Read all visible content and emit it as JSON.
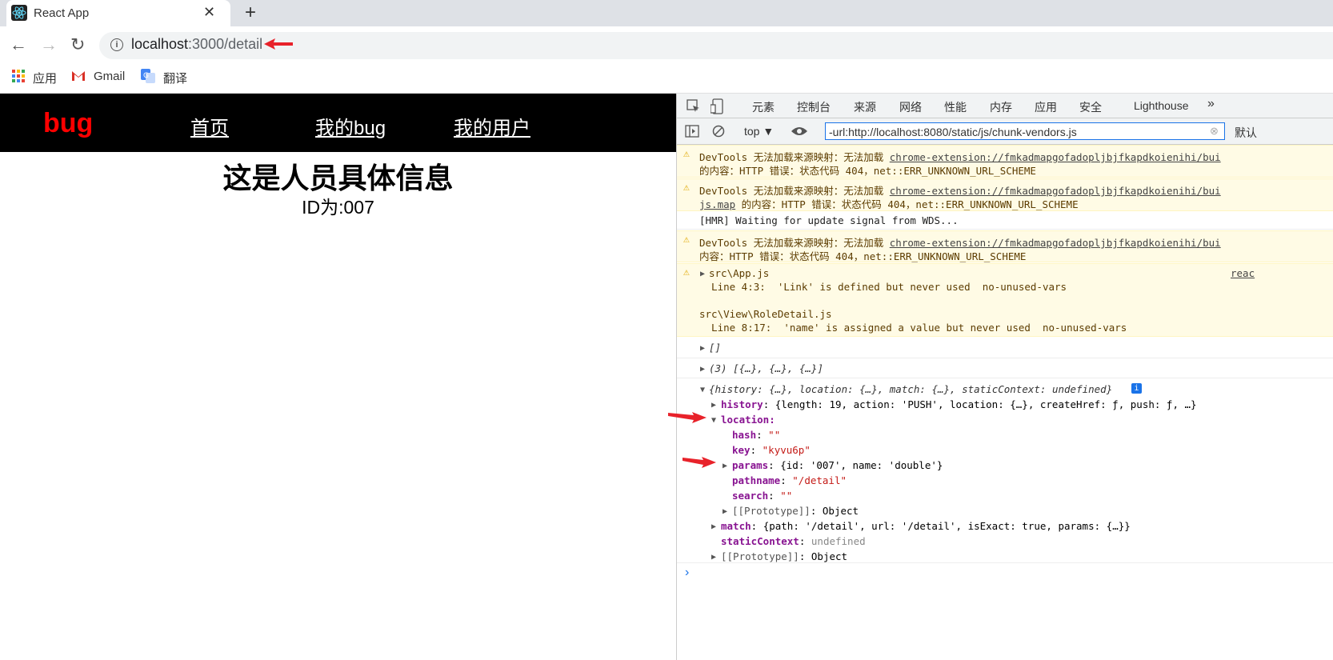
{
  "browser": {
    "tab_title": "React App",
    "tab_close": "✕",
    "new_tab": "+",
    "url_host": "localhost",
    "url_path": ":3000/detail",
    "back": "←",
    "forward": "→",
    "reload": "↻",
    "bookmarks": [
      "应用",
      "Gmail",
      "翻译"
    ]
  },
  "page": {
    "brand": "bug",
    "nav_links": [
      "首页",
      "我的bug",
      "我的用户"
    ],
    "title": "这是人员具体信息",
    "id_text": "ID为:007"
  },
  "devtools": {
    "tabs": [
      "元素",
      "控制台",
      "来源",
      "网络",
      "性能",
      "内存",
      "应用",
      "安全",
      "Lighthouse",
      "»"
    ],
    "context": "top ▼",
    "filter": "-url:http://localhost:8080/static/js/chunk-vendors.js",
    "default_levels": "默认",
    "warnings": [
      {
        "l1a": "DevTools 无法加载来源映射：无法加载 ",
        "l1link": "chrome-extension://fmkadmapgofadopljbjfkapdkoienihi/bui",
        "l2": "的内容：HTTP 错误：状态代码 404，net::ERR_UNKNOWN_URL_SCHEME"
      },
      {
        "l1a": "DevTools 无法加载来源映射：无法加载 ",
        "l1link": "chrome-extension://fmkadmapgofadopljbjfkapdkoienihi/bui",
        "l2link": "js.map",
        "l2": " 的内容：HTTP 错误：状态代码 404，net::ERR_UNKNOWN_URL_SCHEME"
      },
      {
        "l1a": "DevTools 无法加载来源映射：无法加载 ",
        "l1link": "chrome-extension://fmkadmapgofadopljbjfkapdkoienihi/bui",
        "l2": "内容：HTTP 错误：状态代码 404，net::ERR_UNKNOWN_URL_SCHEME"
      }
    ],
    "hmr": "[HMR] Waiting for update signal from WDS...",
    "lint": {
      "file1": "src\\App.js",
      "line1": "  Line 4:3:  'Link' is defined but never used  no-unused-vars",
      "file2": "src\\View\\RoleDetail.js",
      "line2": "  Line 8:17:  'name' is assigned a value but never used  no-unused-vars",
      "source": "reac"
    },
    "log_empty": "[]",
    "log_array": "(3) [{…}, {…}, {…}]",
    "obj_summary": "{history: {…}, location: {…}, match: {…}, staticContext: undefined}",
    "history": "{length: 19, action: 'PUSH', location: {…}, createHref: ƒ, push: ƒ, …}",
    "hash": "\"\"",
    "key": "\"kyvu6p\"",
    "params": "{id: '007', name: 'double'}",
    "pathname": "\"/detail\"",
    "search": "\"\"",
    "proto": "Object",
    "match": "{path: '/detail', url: '/detail', isExact: true, params: {…}}",
    "staticContext": "undefined",
    "prompt": "›"
  },
  "colors": {
    "accent": "#1a73e8",
    "brand": "#ff0000",
    "warn_bg": "#fffbe5"
  }
}
